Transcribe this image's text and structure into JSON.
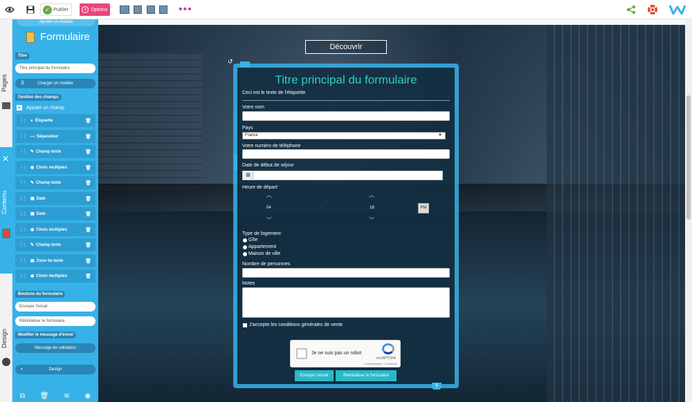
{
  "toolbar": {
    "publish_label": "Publier",
    "options_label": "Options",
    "icons": [
      "eye-icon",
      "save-icon",
      "publish-icon",
      "options-icon",
      "desktop-icon",
      "tablet-landscape-icon",
      "tablet-icon",
      "mobile-icon",
      "more-icon",
      "share-icon",
      "help-icon",
      "logo-icon"
    ],
    "colors": {
      "options": "#e9457a",
      "share": "#6aaa3c",
      "help": "#e14b2c",
      "logo": "#36b2e8"
    }
  },
  "vertical_tabs": {
    "pages": "Pages",
    "contenu": "Contenu",
    "design": "Design"
  },
  "sidebar": {
    "add_module": "Ajouter un module",
    "title": "Formulaire",
    "title_section_label": "Titre",
    "title_value": "Titre principal du formulaire",
    "load_model_button": "Charger un modèle",
    "fields_section_label": "Gestion des champs",
    "add_field_label": "Ajouter un champ",
    "fields": [
      {
        "label": "Étiquette",
        "icon": "tag-icon"
      },
      {
        "label": "Séparateur",
        "icon": "minus-icon"
      },
      {
        "label": "Champ texte",
        "icon": "pencil-icon"
      },
      {
        "label": "Choix multiples",
        "icon": "radio-icon"
      },
      {
        "label": "Champ texte",
        "icon": "pencil-icon"
      },
      {
        "label": "Date",
        "icon": "calendar-icon"
      },
      {
        "label": "Date",
        "icon": "calendar-icon"
      },
      {
        "label": "Choix multiples",
        "icon": "radio-icon"
      },
      {
        "label": "Champ texte",
        "icon": "pencil-icon"
      },
      {
        "label": "Zone de texte",
        "icon": "textarea-icon"
      },
      {
        "label": "Choix multiples",
        "icon": "radio-icon"
      }
    ],
    "buttons_section_label": "Boutons du formulaire",
    "send_email_value": "Envoyer l'email",
    "reset_value": "Réinitialiser le formulaire",
    "modify_message_label": "Modifier le message d'envoi",
    "validation_message_button": "Message de validation",
    "design_button": "Design"
  },
  "page": {
    "discover_button": "Découvrir"
  },
  "form": {
    "title": "Titre principal du formulaire",
    "label_text": "Ceci est le texte de l'étiquette",
    "name_label": "Votre nom",
    "country_label": "Pays",
    "country_value": "France",
    "phone_label": "Votre numéro de téléphone",
    "start_date_label": "Date de début de séjour",
    "departure_time_label": "Heure de départ",
    "required_mark": "*",
    "hour_value": "04",
    "time_separator": ":",
    "minute_value": "18",
    "period_value": "PM",
    "housing_label": "Type de logement",
    "housing_options": [
      "Gîte",
      "Appartement",
      "Maison de ville"
    ],
    "persons_label": "Nombre de personnes",
    "notes_label": "Notes",
    "accept_label": "J'accepte les conditions générales de vente",
    "captcha_text": "Je ne suis pas un robot",
    "captcha_brand": "reCAPTCHA",
    "captcha_links": "Confidentialité - Conditions",
    "send_button": "Envoyer l'email",
    "reset_button": "Réinitialiser le formulaire"
  }
}
